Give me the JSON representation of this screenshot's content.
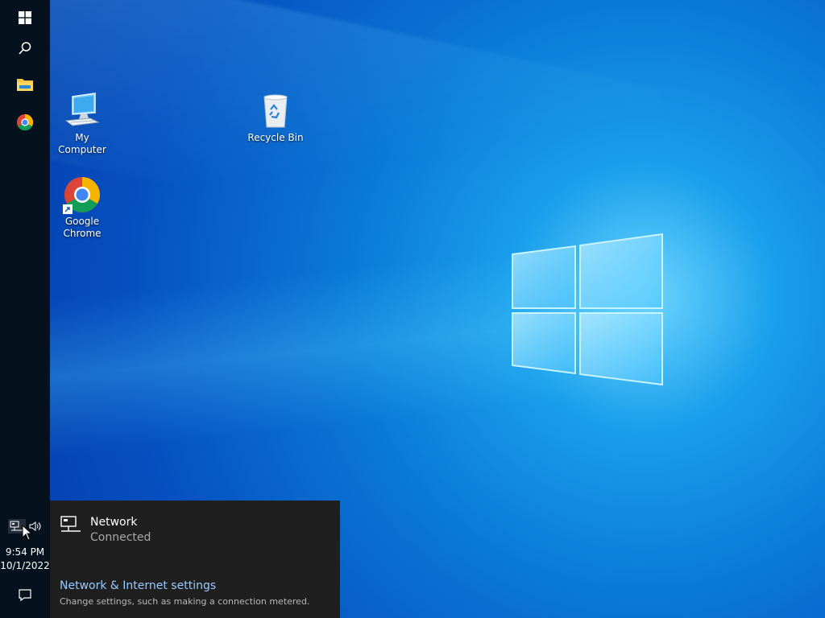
{
  "taskbar": {
    "start_icon": "windows-logo-icon",
    "search_icon": "search-icon",
    "pinned": [
      {
        "name": "file-explorer-icon"
      },
      {
        "name": "chrome-icon"
      }
    ],
    "tray": {
      "network_icon": "network-icon",
      "volume_icon": "volume-icon",
      "time": "9:54 PM",
      "date": "10/1/2022",
      "action_center_icon": "notification-icon"
    }
  },
  "desktop": {
    "icons": [
      {
        "label": "My Computer",
        "icon": "computer-icon"
      },
      {
        "label": "Recycle Bin",
        "icon": "recycle-bin-icon"
      },
      {
        "label": "Google\nChrome",
        "icon": "chrome-shortcut-icon"
      }
    ]
  },
  "network_flyout": {
    "title": "Network",
    "status": "Connected",
    "settings_link": "Network & Internet settings",
    "settings_description": "Change settings, such as making a connection metered."
  },
  "colors": {
    "taskbar_bg": "#05121d",
    "flyout_bg": "#1f1f1f",
    "link_color": "#99c9ff",
    "wallpaper_accent": "#0a78d6"
  }
}
